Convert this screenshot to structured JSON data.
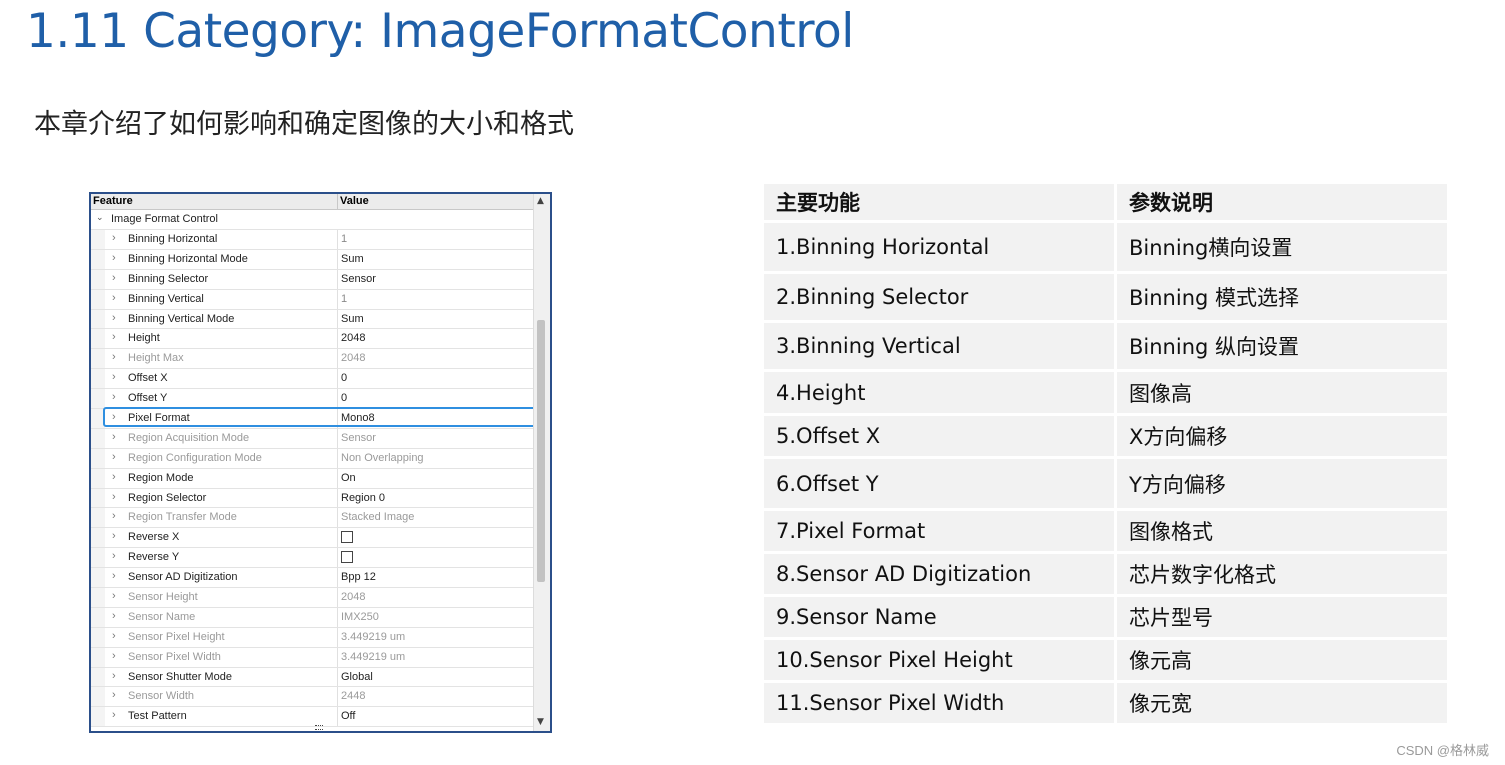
{
  "title": "1.11 Category: ImageFormatControl",
  "subtitle": "本章介绍了如何影响和确定图像的大小和格式",
  "feature_grid": {
    "header_feature": "Feature",
    "header_value": "Value",
    "group_label": "Image Format Control",
    "rows": [
      {
        "name": "Binning Horizontal",
        "value": "1",
        "state": "ro"
      },
      {
        "name": "Binning Horizontal Mode",
        "value": "Sum",
        "state": "rw"
      },
      {
        "name": "Binning Selector",
        "value": "Sensor",
        "state": "rw"
      },
      {
        "name": "Binning Vertical",
        "value": "1",
        "state": "ro"
      },
      {
        "name": "Binning Vertical Mode",
        "value": "Sum",
        "state": "rw"
      },
      {
        "name": "Height",
        "value": "2048",
        "state": "rw"
      },
      {
        "name": "Height Max",
        "value": "2048",
        "state": "dim"
      },
      {
        "name": "Offset X",
        "value": "0",
        "state": "rw"
      },
      {
        "name": "Offset Y",
        "value": "0",
        "state": "rw"
      },
      {
        "name": "Pixel Format",
        "value": "Mono8",
        "state": "rw"
      },
      {
        "name": "Region Acquisition Mode",
        "value": "Sensor",
        "state": "dim"
      },
      {
        "name": "Region Configuration Mode",
        "value": "Non Overlapping",
        "state": "dim"
      },
      {
        "name": "Region Mode",
        "value": "On",
        "state": "rw"
      },
      {
        "name": "Region Selector",
        "value": "Region 0",
        "state": "rw"
      },
      {
        "name": "Region Transfer Mode",
        "value": "Stacked Image",
        "state": "dim"
      },
      {
        "name": "Reverse X",
        "value": "",
        "state": "checkbox"
      },
      {
        "name": "Reverse Y",
        "value": "",
        "state": "checkbox"
      },
      {
        "name": "Sensor AD Digitization",
        "value": "Bpp 12",
        "state": "rw"
      },
      {
        "name": "Sensor Height",
        "value": "2048",
        "state": "dim"
      },
      {
        "name": "Sensor Name",
        "value": "IMX250",
        "state": "dim"
      },
      {
        "name": "Sensor Pixel Height",
        "value": "3.449219 um",
        "state": "dim"
      },
      {
        "name": "Sensor Pixel Width",
        "value": "3.449219 um",
        "state": "dim"
      },
      {
        "name": "Sensor Shutter Mode",
        "value": "Global",
        "state": "rw"
      },
      {
        "name": "Sensor Width",
        "value": "2448",
        "state": "dim"
      },
      {
        "name": "Test Pattern",
        "value": "Off",
        "state": "rw"
      }
    ]
  },
  "desc_table": {
    "headers": [
      "主要功能",
      "参数说明"
    ],
    "rows": [
      [
        "1.Binning Horizontal",
        "Binning横向设置"
      ],
      [
        "2.Binning Selector",
        "Binning 模式选择"
      ],
      [
        "3.Binning Vertical",
        "Binning 纵向设置"
      ],
      [
        "4.Height",
        "图像高"
      ],
      [
        "5.Offset X",
        "X方向偏移"
      ],
      [
        "6.Offset Y",
        "Y方向偏移"
      ],
      [
        "7.Pixel Format",
        "图像格式"
      ],
      [
        "8.Sensor AD Digitization",
        "芯片数字化格式"
      ],
      [
        "9.Sensor Name",
        "芯片型号"
      ],
      [
        "10.Sensor Pixel Height",
        "像元高"
      ],
      [
        "11.Sensor Pixel Width",
        "像元宽"
      ]
    ]
  },
  "watermark": "CSDN @格林威",
  "colors": {
    "title": "#1f5fa8",
    "panel_border": "#2b4f8a",
    "selection_highlight": "#2f8fe0",
    "table_cell_bg": "#f2f2f2"
  }
}
